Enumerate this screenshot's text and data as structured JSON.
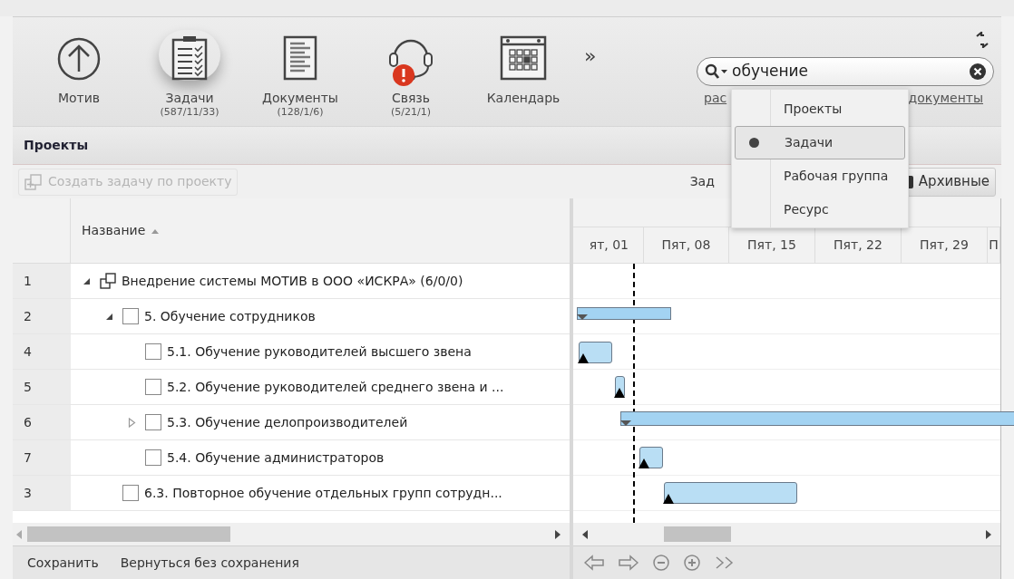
{
  "toolbar": {
    "items": [
      {
        "kind": "motiv",
        "label": "Мотив",
        "selected": false,
        "alert": false
      },
      {
        "kind": "tasks",
        "label": "Задачи",
        "counts": "(587/11/33)",
        "selected": true,
        "alert": false
      },
      {
        "kind": "documents",
        "label": "Документы",
        "counts": "(128/1/6)",
        "selected": false,
        "alert": false
      },
      {
        "kind": "communication",
        "label": "Связь",
        "counts": "(5/21/1)",
        "selected": false,
        "alert": true
      },
      {
        "kind": "calendar",
        "label": "Календарь",
        "selected": false,
        "alert": false
      }
    ],
    "more": "»"
  },
  "search": {
    "value": "обучение",
    "links": [
      "рас",
      "документы"
    ],
    "menu": [
      {
        "label": "Проекты",
        "selected": false
      },
      {
        "label": "Задачи",
        "selected": true
      },
      {
        "label": "Рабочая группа",
        "selected": false
      },
      {
        "label": "Ресурс",
        "selected": false
      }
    ]
  },
  "section": {
    "title": "Проекты"
  },
  "actions": {
    "create": {
      "label": "Создать задачу по проекту",
      "disabled": true
    },
    "filter_label": "Зад",
    "archive": {
      "label": "Архивные",
      "checked": true
    }
  },
  "table": {
    "column": "Название",
    "sort_ascending": true,
    "rows": [
      {
        "number": "1",
        "kind": "project",
        "title": "Внедрение системы МОТИВ в ООО «ИСКРА» (6/0/0)",
        "expanded": true,
        "children": [
          {
            "number": "2",
            "kind": "task",
            "title": "5. Обучение сотрудников",
            "checked": false,
            "expanded": true,
            "children": [
              {
                "number": "4",
                "kind": "task",
                "title": "5.1. Обучение руководителей высшего звена",
                "checked": false
              },
              {
                "number": "5",
                "kind": "task",
                "title": "5.2. Обучение руководителей среднего звена и ...",
                "checked": false
              },
              {
                "number": "6",
                "kind": "task",
                "title": "5.3. Обучение делопроизводителей",
                "checked": false,
                "expanded": false
              },
              {
                "number": "7",
                "kind": "task",
                "title": "5.4. Обучение администраторов",
                "checked": false
              }
            ]
          },
          {
            "number": "3",
            "kind": "task",
            "title": "6.3. Повторное обучение отдельных групп сотрудн...",
            "checked": false
          }
        ]
      }
    ]
  },
  "gantt": {
    "dates": [
      "ят, 01",
      "Пят, 08",
      "Пят, 15",
      "Пят, 22",
      "Пят, 29",
      "П"
    ]
  },
  "footer": {
    "buttons": [
      "Сохранить",
      "Вернуться без сохранения"
    ]
  }
}
